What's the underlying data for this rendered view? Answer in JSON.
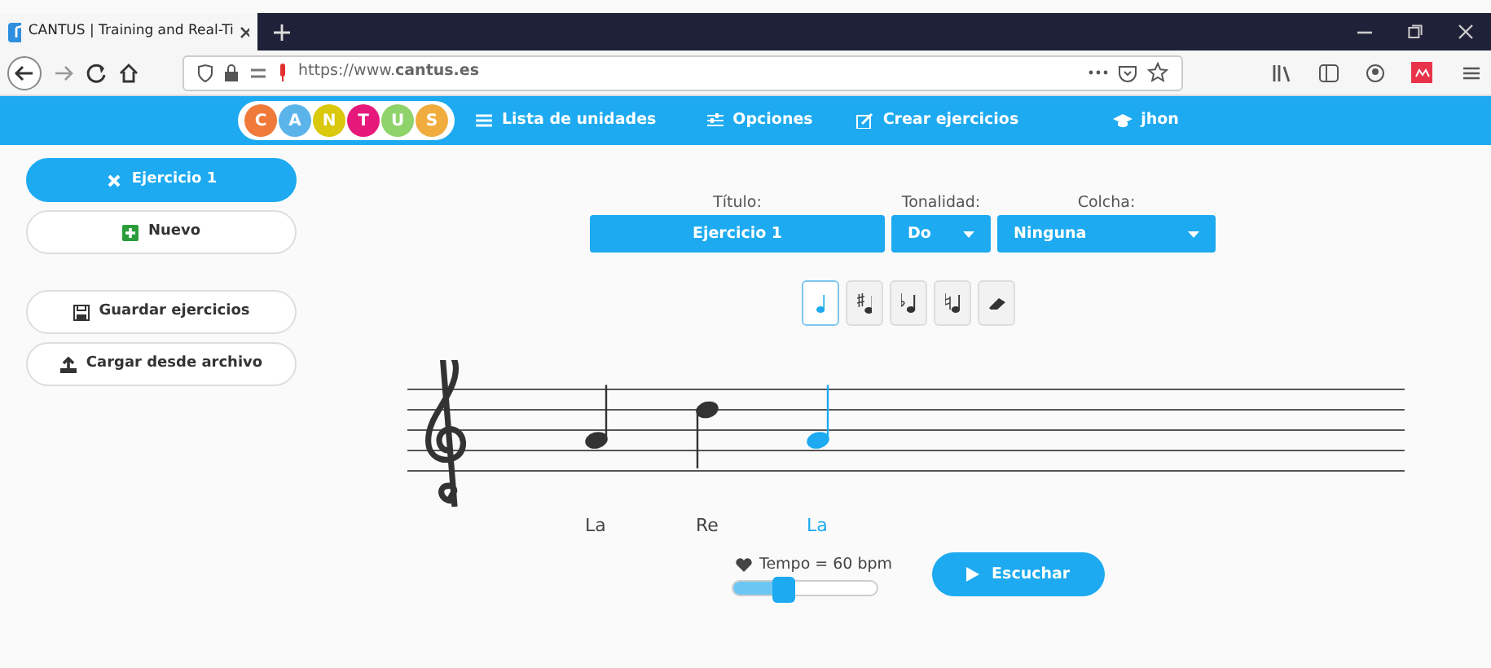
{
  "browser": {
    "tab_title": "CANTUS | Training and Real-Ti",
    "url": "https://www.**cantus.es**"
  },
  "logo": [
    {
      "letter": "C",
      "color": "#f07a3a"
    },
    {
      "letter": "A",
      "color": "#5ab4ea"
    },
    {
      "letter": "N",
      "color": "#d9c80c"
    },
    {
      "letter": "T",
      "color": "#e6197a"
    },
    {
      "letter": "U",
      "color": "#8fd36b"
    },
    {
      "letter": "S",
      "color": "#f0ad3e"
    }
  ],
  "nav": [
    {
      "kind": "list",
      "label": "Lista de unidades"
    },
    {
      "kind": "options",
      "label": "Opciones"
    },
    {
      "kind": "edit",
      "label": "Crear ejercicios"
    },
    {
      "kind": "user",
      "label": "jhon"
    }
  ],
  "sidebar": [
    {
      "kind": "close",
      "label": "Ejercicio 1",
      "selected": true
    },
    {
      "kind": "add",
      "label": "Nuevo",
      "selected": false
    },
    {
      "kind": "save",
      "label": "Guardar ejercicios",
      "selected": false
    },
    {
      "kind": "upload",
      "label": "Cargar desde archivo",
      "selected": false
    }
  ],
  "form": {
    "title": {
      "label": "Título:",
      "value": "Ejercicio 1"
    },
    "key": {
      "label": "Tonalidad:",
      "value": "Do"
    },
    "quilt": {
      "label": "Colcha:",
      "value": "Ninguna"
    }
  },
  "tools": [
    {
      "kind": "note",
      "selected": true
    },
    {
      "kind": "sharp",
      "selected": false
    },
    {
      "kind": "flat",
      "selected": false
    },
    {
      "kind": "natural",
      "selected": false
    },
    {
      "kind": "eraser",
      "selected": false
    }
  ],
  "notes": [
    {
      "kind": "a4",
      "name": "La",
      "selected": false
    },
    {
      "kind": "d5",
      "name": "Re",
      "selected": false
    },
    {
      "kind": "a4",
      "name": "La",
      "selected": true
    }
  ],
  "tempo": {
    "label": "Tempo = 60 bpm",
    "level": 0.35
  },
  "play_button": "Escuchar"
}
